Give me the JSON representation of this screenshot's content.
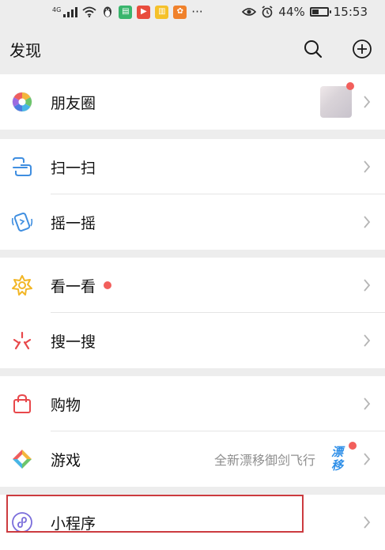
{
  "status_bar": {
    "network": "4G",
    "battery": "44%",
    "battery_level": 0.44,
    "time": "15:53",
    "more": "···",
    "app_icons": [
      "penguin-icon",
      "chat-app-icon",
      "video-app-icon",
      "news-app-icon",
      "shop-app-icon"
    ]
  },
  "header": {
    "title": "发现"
  },
  "moments": {
    "label": "朋友圈"
  },
  "scan": {
    "label": "扫一扫"
  },
  "shake": {
    "label": "摇一摇"
  },
  "look": {
    "label": "看一看"
  },
  "search": {
    "label": "搜一搜"
  },
  "shopping": {
    "label": "购物"
  },
  "games": {
    "label": "游戏",
    "description": "全新漂移御剑飞行",
    "logo_line1": "漂",
    "logo_line2": "移"
  },
  "mini_programs": {
    "label": "小程序"
  },
  "colors": {
    "accent_red": "#f25f5c",
    "highlight": "#cc3b3f",
    "page_bg": "#ededed",
    "section_bg": "#ffffff",
    "muted_text": "#8f8f8f"
  }
}
